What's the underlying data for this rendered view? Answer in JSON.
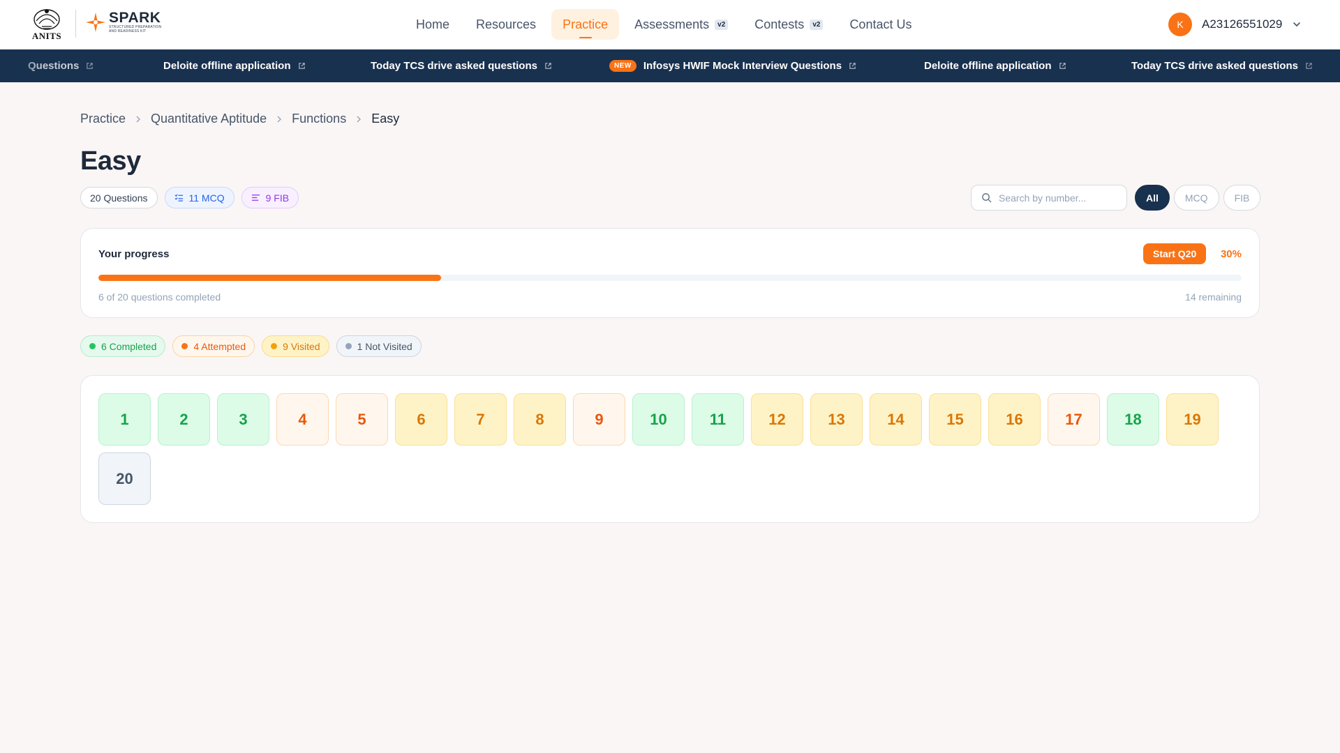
{
  "header": {
    "anits_logo_text": "ANITS",
    "spark_title": "SPARK",
    "spark_subtitle": "Structured Preparation and Readiness Kit",
    "nav": [
      {
        "label": "Home",
        "active": false,
        "badge": ""
      },
      {
        "label": "Resources",
        "active": false,
        "badge": ""
      },
      {
        "label": "Practice",
        "active": true,
        "badge": ""
      },
      {
        "label": "Assessments",
        "active": false,
        "badge": "v2"
      },
      {
        "label": "Contests",
        "active": false,
        "badge": "v2"
      },
      {
        "label": "Contact Us",
        "active": false,
        "badge": ""
      }
    ],
    "user": {
      "avatar_initial": "K",
      "id": "A23126551029"
    }
  },
  "ticker": [
    {
      "text": "Questions",
      "new": false
    },
    {
      "text": "Deloite offline application",
      "new": false
    },
    {
      "text": "Today TCS drive asked questions",
      "new": false
    },
    {
      "text": "Infosys HWIF Mock Interview Questions",
      "new": true
    },
    {
      "text": "Deloite offline application",
      "new": false
    },
    {
      "text": "Today TCS drive asked questions",
      "new": false
    }
  ],
  "ticker_badge": "NEW",
  "breadcrumb": [
    "Practice",
    "Quantitative Aptitude",
    "Functions",
    "Easy"
  ],
  "page": {
    "title": "Easy",
    "total_questions": "20 Questions",
    "mcq_count": "11 MCQ",
    "fib_count": "9 FIB"
  },
  "search": {
    "placeholder": "Search by number..."
  },
  "filters": [
    {
      "label": "All",
      "active": true
    },
    {
      "label": "MCQ",
      "active": false
    },
    {
      "label": "FIB",
      "active": false
    }
  ],
  "progress": {
    "label": "Your progress",
    "start_button": "Start Q20",
    "percent_text": "30%",
    "percent_value": 30,
    "completed_text": "6 of 20 questions completed",
    "remaining_text": "14 remaining"
  },
  "legend": {
    "completed": "6 Completed",
    "attempted": "4 Attempted",
    "visited": "9 Visited",
    "not_visited": "1 Not Visited"
  },
  "questions": [
    {
      "n": "1",
      "status": "completed"
    },
    {
      "n": "2",
      "status": "completed"
    },
    {
      "n": "3",
      "status": "completed"
    },
    {
      "n": "4",
      "status": "attempted"
    },
    {
      "n": "5",
      "status": "attempted"
    },
    {
      "n": "6",
      "status": "visited"
    },
    {
      "n": "7",
      "status": "visited"
    },
    {
      "n": "8",
      "status": "visited"
    },
    {
      "n": "9",
      "status": "attempted"
    },
    {
      "n": "10",
      "status": "completed"
    },
    {
      "n": "11",
      "status": "completed"
    },
    {
      "n": "12",
      "status": "visited"
    },
    {
      "n": "13",
      "status": "visited"
    },
    {
      "n": "14",
      "status": "visited"
    },
    {
      "n": "15",
      "status": "visited"
    },
    {
      "n": "16",
      "status": "visited"
    },
    {
      "n": "17",
      "status": "attempted"
    },
    {
      "n": "18",
      "status": "completed"
    },
    {
      "n": "19",
      "status": "visited"
    },
    {
      "n": "20",
      "status": "notvisited"
    }
  ],
  "colors": {
    "accent": "#f97316",
    "navy": "#18314f",
    "completed": "#16a34a",
    "attempted": "#ea580c",
    "visited": "#d97706",
    "not_visited": "#475569"
  },
  "icons": {
    "ticker_link": "external-link-icon",
    "breadcrumb_sep": "chevron-right-icon",
    "search": "search-icon",
    "user_menu": "chevron-down-icon",
    "mcq": "list-check-icon",
    "fib": "text-lines-icon"
  }
}
